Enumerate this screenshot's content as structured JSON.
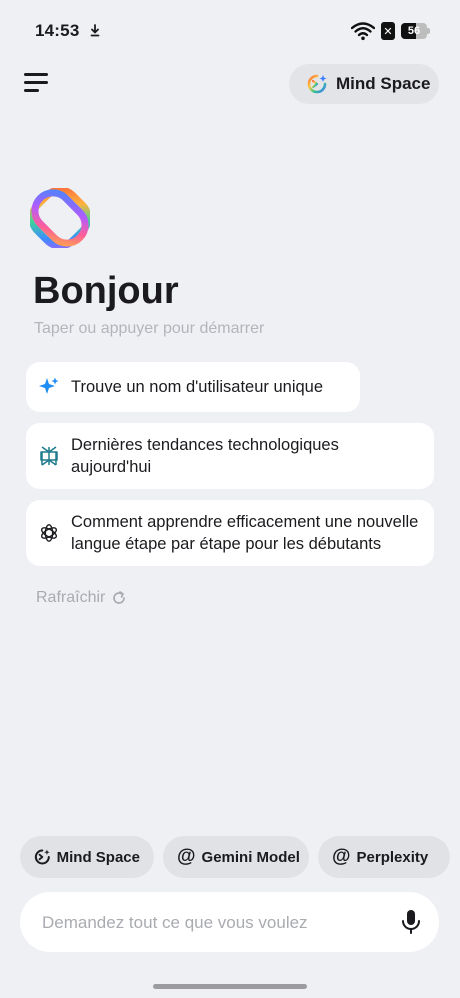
{
  "status_bar": {
    "time": "14:53",
    "battery_level": "56",
    "battery_percent": 56
  },
  "header": {
    "mind_space_label": "Mind Space"
  },
  "greeting": {
    "title": "Bonjour",
    "subtitle": "Taper ou appuyer pour démarrer"
  },
  "suggestions": [
    {
      "icon": "sparkle-icon",
      "text": "Trouve un nom d'utilisateur unique"
    },
    {
      "icon": "perplexity-icon",
      "text": "Dernières tendances technologiques aujourd'hui"
    },
    {
      "icon": "openai-icon",
      "text": "Comment apprendre efficacement une nouvelle langue étape par étape pour les débutants"
    }
  ],
  "refresh_label": "Rafraîchir",
  "model_chips": [
    {
      "icon": "mind-space-icon",
      "label": "Mind Space"
    },
    {
      "icon": "at-icon",
      "label": "Gemini Model"
    },
    {
      "icon": "at-icon",
      "label": "Perplexity"
    }
  ],
  "input": {
    "placeholder": "Demandez tout ce que vous voulez",
    "value": ""
  },
  "colors": {
    "background": "#eff0f3",
    "card": "#ffffff",
    "chip": "#e1e2e6",
    "accent_blue": "#1e8ef5",
    "perplexity_teal": "#1f7a8c"
  }
}
